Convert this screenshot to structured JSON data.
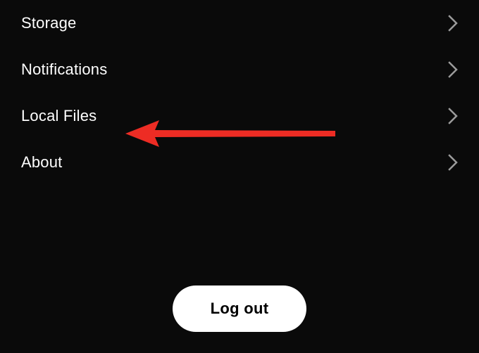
{
  "settings": {
    "items": [
      {
        "label": "Storage"
      },
      {
        "label": "Notifications"
      },
      {
        "label": "Local Files"
      },
      {
        "label": "About"
      }
    ]
  },
  "logout": {
    "label": "Log out"
  },
  "colors": {
    "background": "#0a0a0a",
    "text": "#ffffff",
    "chevron": "#9b9b9b",
    "annotation": "#ed2c24"
  }
}
